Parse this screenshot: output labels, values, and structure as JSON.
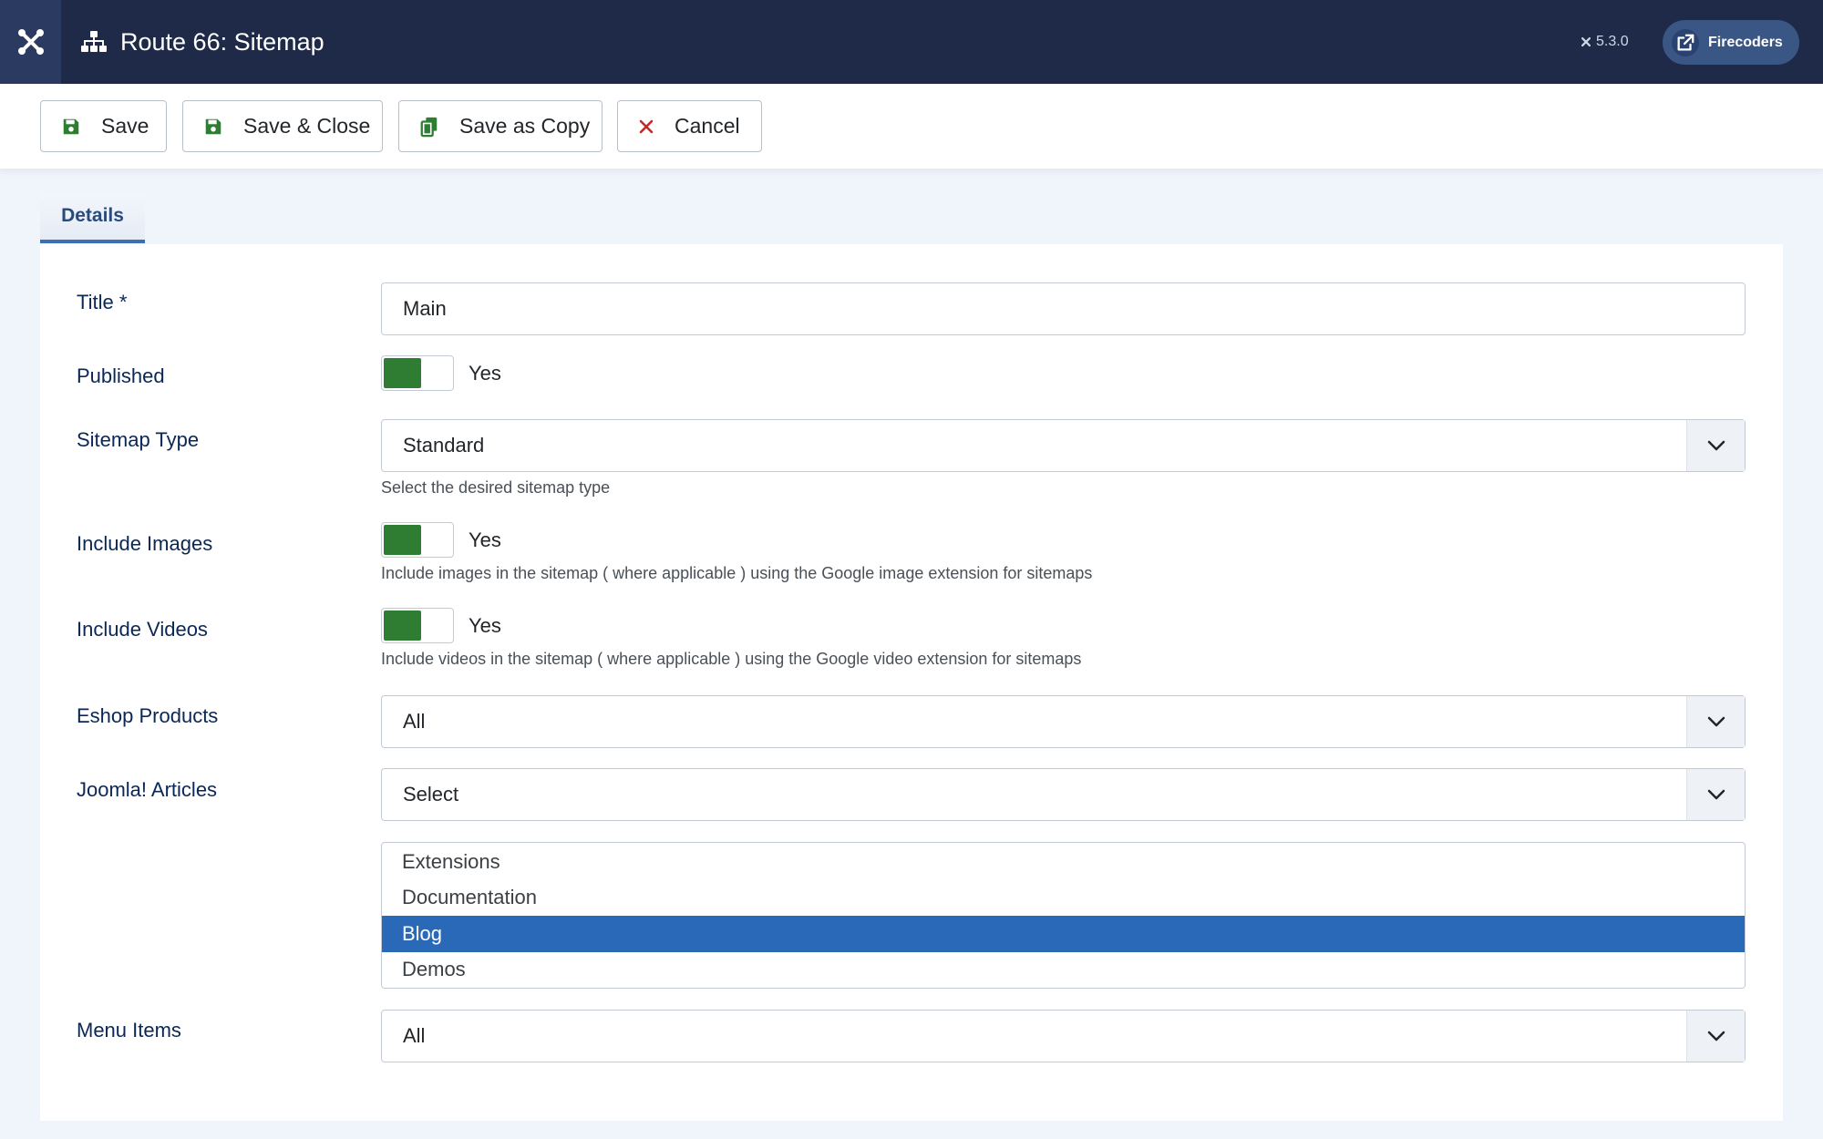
{
  "header": {
    "page_title": "Route 66: Sitemap",
    "version": "5.3.0",
    "user_button": "Firecoders"
  },
  "toolbar": {
    "save_label": "Save",
    "save_close_label": "Save & Close",
    "save_copy_label": "Save as Copy",
    "cancel_label": "Cancel"
  },
  "tabs": [
    {
      "label": "Details"
    }
  ],
  "form": {
    "title": {
      "label": "Title *",
      "value": "Main"
    },
    "published": {
      "label": "Published",
      "state": "Yes"
    },
    "sitemap_type": {
      "label": "Sitemap Type",
      "value": "Standard",
      "help": "Select the desired sitemap type"
    },
    "include_images": {
      "label": "Include Images",
      "state": "Yes",
      "help": "Include images in the sitemap ( where applicable ) using the Google image extension for sitemaps"
    },
    "include_videos": {
      "label": "Include Videos",
      "state": "Yes",
      "help": "Include videos in the sitemap ( where applicable ) using the Google video extension for sitemaps"
    },
    "eshop_products": {
      "label": "Eshop Products",
      "value": "All"
    },
    "joomla_articles": {
      "label": "Joomla! Articles",
      "value": "Select",
      "options": [
        "Extensions",
        "Documentation",
        "Blog",
        "Demos"
      ],
      "selected_option": "Blog"
    },
    "menu_items": {
      "label": "Menu Items",
      "value": "All"
    }
  },
  "colors": {
    "header_bg": "#1f2a48",
    "toggle_on": "#2e7d32",
    "selected_option": "#2a69b8",
    "label_text": "#0a2756"
  }
}
